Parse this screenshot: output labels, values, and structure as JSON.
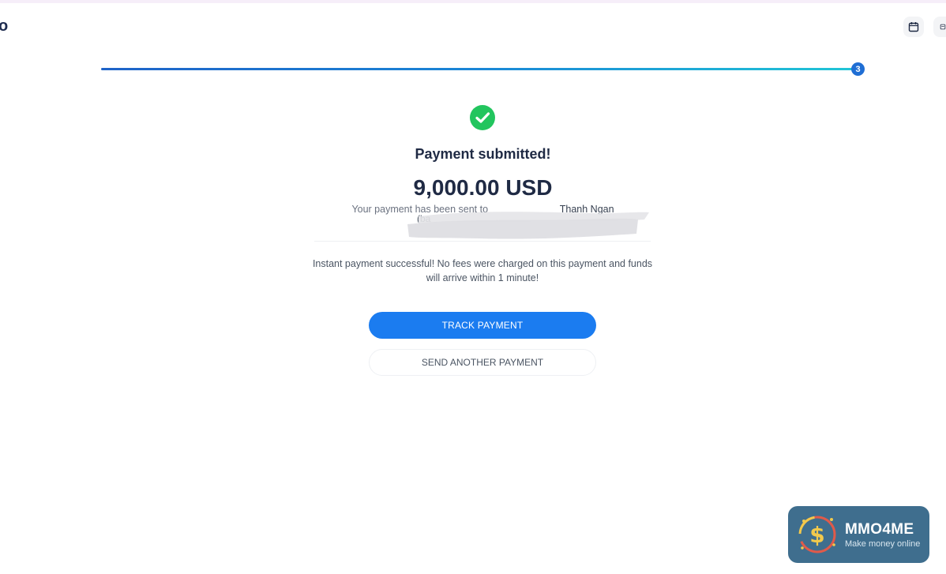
{
  "header": {
    "logo_fragment": "o",
    "icons": [
      "calendar-icon",
      "receipt-icon"
    ]
  },
  "progress": {
    "current_step": "3",
    "fraction": 1.0
  },
  "confirmation": {
    "title": "Payment submitted!",
    "amount": "9,000.00 USD",
    "recipient_prefix": "Your payment has been sent to",
    "recipient_name_partial": "Thanh Ngan",
    "recipient_line2_partial": "(ba"
  },
  "note": "Instant payment successful! No fees were charged on this payment and funds will arrive within 1 minute!",
  "buttons": {
    "track": "TRACK PAYMENT",
    "send_another": "SEND ANOTHER PAYMENT"
  },
  "watermark": {
    "title": "MMO4ME",
    "subtitle": "Make money online"
  },
  "colors": {
    "primary": "#1b7cf0",
    "success": "#22c55e",
    "progress_start": "#1f63c8",
    "progress_end": "#21c6d6"
  }
}
